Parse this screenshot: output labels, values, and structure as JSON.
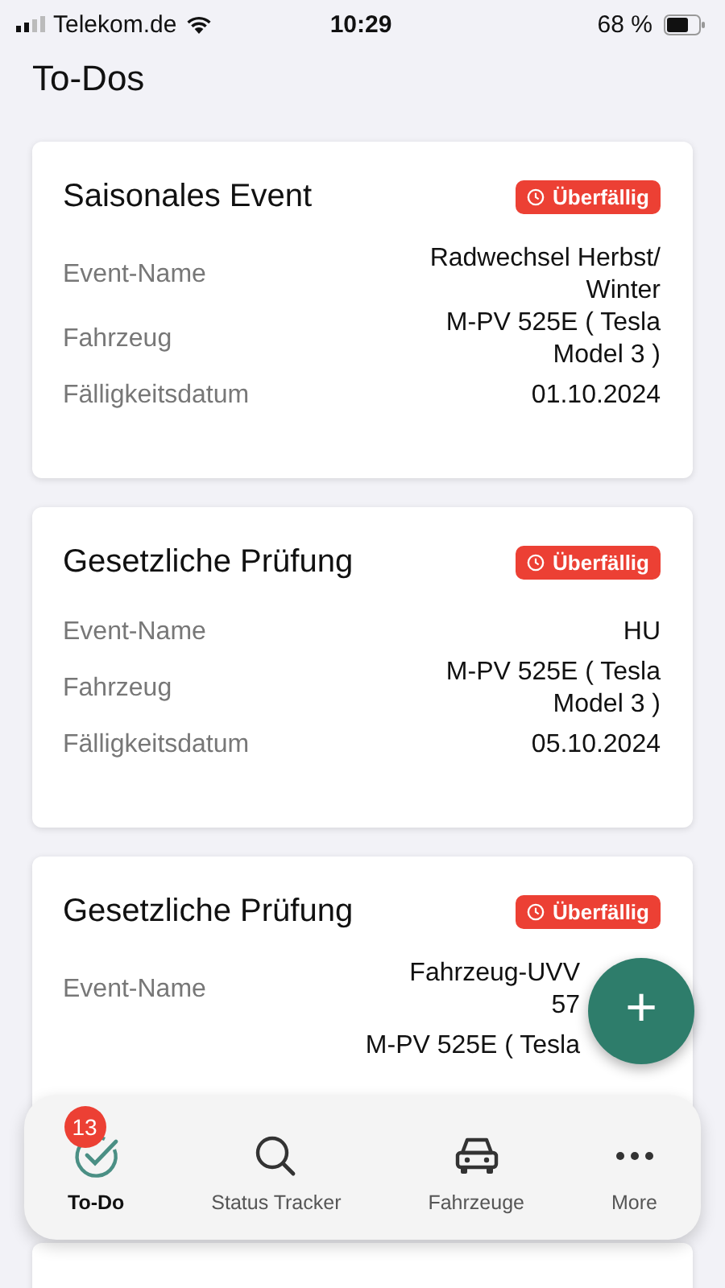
{
  "status_bar": {
    "carrier": "Telekom.de",
    "time": "10:29",
    "battery": "68 %"
  },
  "title": "To-Dos",
  "cards": [
    {
      "title": "Saisonales Event",
      "badge": "Überfällig",
      "rows": [
        {
          "label": "Event-Name",
          "value": "Radwechsel Herbst/\nWinter"
        },
        {
          "label": "Fahrzeug",
          "value": "M-PV 525E ( Tesla\nModel 3 )"
        },
        {
          "label": "Fälligkeitsdatum",
          "value": "01.10.2024"
        }
      ]
    },
    {
      "title": "Gesetzliche Prüfung",
      "badge": "Überfällig",
      "rows": [
        {
          "label": "Event-Name",
          "value": "HU"
        },
        {
          "label": "Fahrzeug",
          "value": "M-PV 525E ( Tesla\nModel 3 )"
        },
        {
          "label": "Fälligkeitsdatum",
          "value": "05.10.2024"
        }
      ]
    },
    {
      "title": "Gesetzliche Prüfung",
      "badge": "Überfällig",
      "rows": [
        {
          "label": "Event-Name",
          "value": "Fahrzeug-UVV\n57"
        },
        {
          "value": "M-PV 525E ( Tesla"
        }
      ]
    }
  ],
  "fab": "+",
  "nav": [
    {
      "kind": "check",
      "label": "To-Do",
      "selected": true,
      "badge": "13"
    },
    {
      "kind": "search",
      "label": "Status Tracker",
      "selected": false
    },
    {
      "kind": "car",
      "label": "Fahrzeuge",
      "selected": false
    },
    {
      "kind": "more",
      "label": "More",
      "selected": false
    }
  ]
}
